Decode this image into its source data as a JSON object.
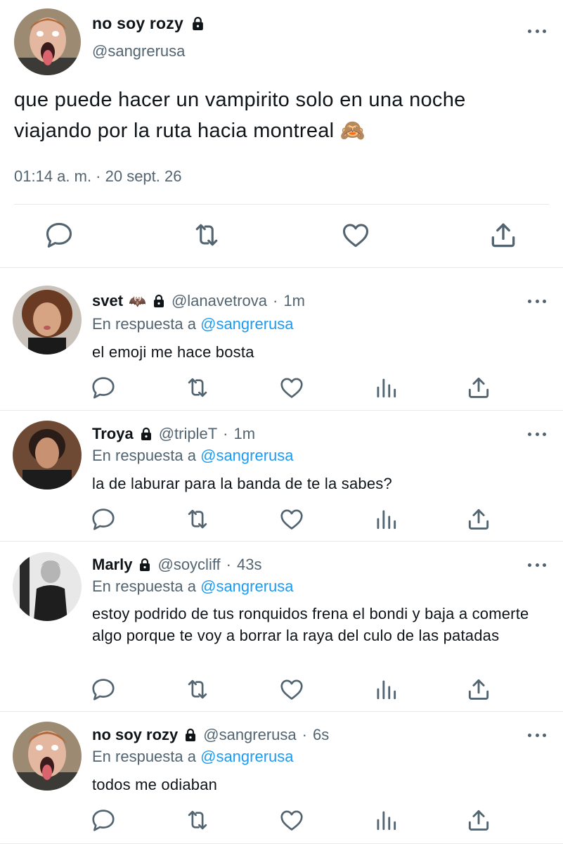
{
  "main_tweet": {
    "name": "no soy rozy",
    "handle": "@sangrerusa",
    "text": "que puede hacer un vampirito solo en una noche viajando por la ruta hacia montreal 🙈",
    "timestamp": "01:14 a. m. · 20 sept. 26",
    "icons": [
      "lock-icon",
      "more-icon",
      "reply-icon",
      "retweet-icon",
      "like-icon",
      "share-icon"
    ]
  },
  "replies": [
    {
      "name": "svet",
      "emoji": "🦇",
      "handle": "@lanavetrova",
      "dot": "·",
      "time": "1m",
      "reply_prefix": "En respuesta a",
      "reply_to": "@sangrerusa",
      "text": "el emoji me hace bosta"
    },
    {
      "name": "Troya",
      "handle": "@tripleT",
      "dot": "·",
      "time": "1m",
      "reply_prefix": "En respuesta a",
      "reply_to": "@sangrerusa",
      "text": "la de laburar para la banda de te la sabes?"
    },
    {
      "name": "Marly",
      "handle": "@soycliff",
      "dot": "·",
      "time": "43s",
      "reply_prefix": "En respuesta a",
      "reply_to": "@sangrerusa",
      "text": "estoy podrido de tus ronquidos frena el bondi y baja a comerte algo porque te voy a borrar la raya del culo de las patadas"
    },
    {
      "name": "no soy rozy",
      "handle": "@sangrerusa",
      "dot": "·",
      "time": "6s",
      "reply_prefix": "En respuesta a",
      "reply_to": "@sangrerusa",
      "text": "todos me odiaban"
    }
  ],
  "colors": {
    "text": "#0f1419",
    "secondary": "#536471",
    "link": "#1d9bf0",
    "divider": "#e6e9eb"
  }
}
